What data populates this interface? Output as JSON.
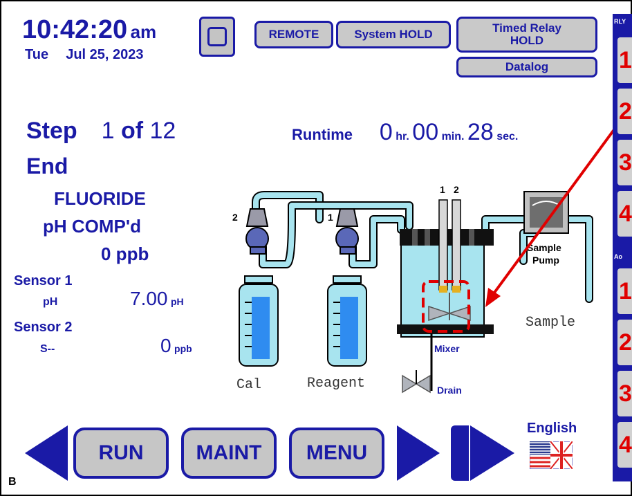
{
  "header": {
    "time": "10:42:20",
    "ampm": "am",
    "day": "Tue",
    "date": "Jul 25, 2023",
    "remote_label": "REMOTE",
    "hold_label": "System HOLD",
    "timed_relay_label": "Timed Relay\nHOLD",
    "datalog_label": "Datalog"
  },
  "step": {
    "label": "Step",
    "current": "1",
    "of_label": "of",
    "total": "12",
    "status": "End"
  },
  "runtime": {
    "label": "Runtime",
    "hours": "0",
    "hr_unit": "hr.",
    "minutes": "00",
    "min_unit": "min.",
    "seconds": "28",
    "sec_unit": "sec."
  },
  "analysis": {
    "name": "FLUORIDE",
    "mode": "pH COMP'd",
    "result": "0 ppb"
  },
  "sensors": [
    {
      "label": "Sensor 1",
      "type": "pH",
      "value": "7.00",
      "unit": "pH"
    },
    {
      "label": "Sensor 2",
      "type": "S--",
      "value": "0",
      "unit": "ppb"
    }
  ],
  "diagram": {
    "pump_cal_num": "2",
    "pump_reagent_num": "1",
    "electrode_1": "1",
    "electrode_2": "2",
    "cal_label": "Cal",
    "reagent_label": "Reagent",
    "sample_pump_label": "Sample\nPump",
    "sample_label": "Sample",
    "mixer_label": "Mixer",
    "drain_label": "Drain"
  },
  "nav": {
    "run_label": "RUN",
    "maint_label": "MAINT",
    "menu_label": "MENU",
    "language_label": "English",
    "footer_letter": "B"
  },
  "sidebar": {
    "rly_label": "RLY",
    "ao_label": "Ao",
    "relays": [
      "1",
      "2",
      "3",
      "4"
    ],
    "analog_outputs": [
      "1",
      "2",
      "3",
      "4"
    ]
  },
  "colors": {
    "primary": "#1a1aa6",
    "button_gray": "#c9c9c9",
    "relay_number": "#e00000",
    "tubing": "#a8e4ef",
    "annotation": "#e00000"
  }
}
